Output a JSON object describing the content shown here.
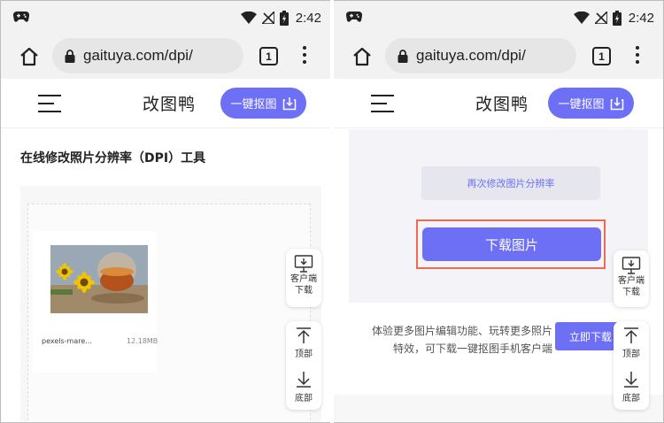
{
  "status_bar": {
    "time": "2:42"
  },
  "address_bar": {
    "url": "gaituya.com/dpi/",
    "tab_count": "1"
  },
  "site_header": {
    "logo": "改图鸭",
    "cta_label": "一键抠图"
  },
  "left_screen": {
    "page_title": "在线修改照片分辨率（DPI）工具",
    "file": {
      "name": "pexels-mare...",
      "size": "12.18MB"
    }
  },
  "right_screen": {
    "redo_label": "再次修改图片分辨率",
    "download_label": "下载图片",
    "promo_text_line1": "体验更多图片编辑功能、玩转更多照片",
    "promo_text_line2": "特效，可下载一键抠图手机客户端",
    "promo_button": "立即下载"
  },
  "float": {
    "client_line1": "客户端",
    "client_line2": "下载",
    "top_label": "顶部",
    "bottom_label": "底部"
  },
  "colors": {
    "accent": "#6d6ff5",
    "highlight": "#ef6a50"
  }
}
